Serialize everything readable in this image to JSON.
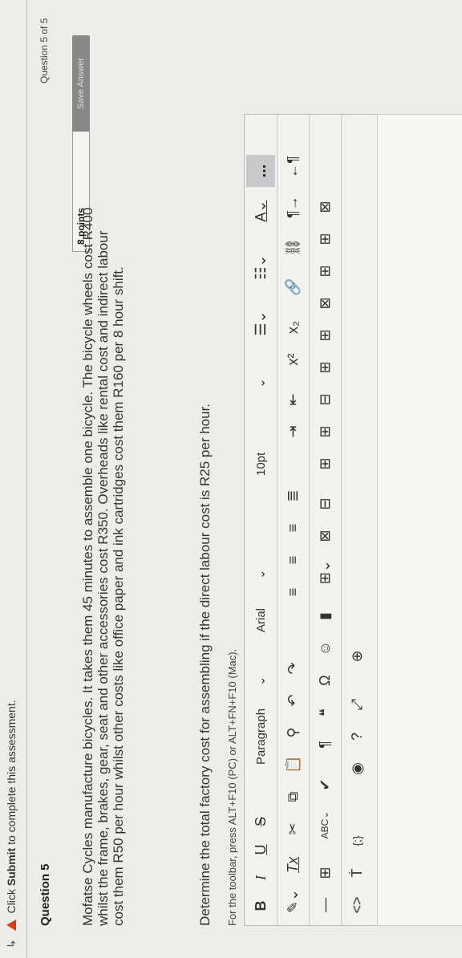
{
  "alert": {
    "prefix": "Click ",
    "action": "Submit",
    "suffix": " to complete this assessment."
  },
  "question": {
    "title": "Question 5",
    "counter": "Question 5 of 5",
    "points": "8 points",
    "save_label": "Save Answer",
    "text": "Mofatse Cycles manufacture bicycles. It takes them 45 minutes to assemble one bicycle. The bicycle wheels cost R400 whilst the frame, brakes, gear, seat and other accessories cost R350. Overheads like rental cost and indirect labour cost them R50 per hour whilst other costs like office paper and ink cartridges cost them R160 per 8 hour shift.",
    "prompt": "Determine the total factory cost for assembling if the direct labour cost is R25 per hour."
  },
  "editor": {
    "toolbar_hint": "For the toolbar, press ALT+F10 (PC) or ALT+FN+F10 (Mac).",
    "row1": {
      "bold": "B",
      "italic": "I",
      "underline": "U",
      "strike": "S",
      "paragraph": "Paragraph",
      "font": "Arial",
      "size": "10pt",
      "more": "..."
    },
    "row2": {
      "clear": "Tx",
      "superscript": "x²",
      "subscript": "x₂"
    },
    "row3": {
      "spell": "ABC"
    }
  },
  "icons": {
    "warn": "warning-icon",
    "more": "more-icon"
  }
}
